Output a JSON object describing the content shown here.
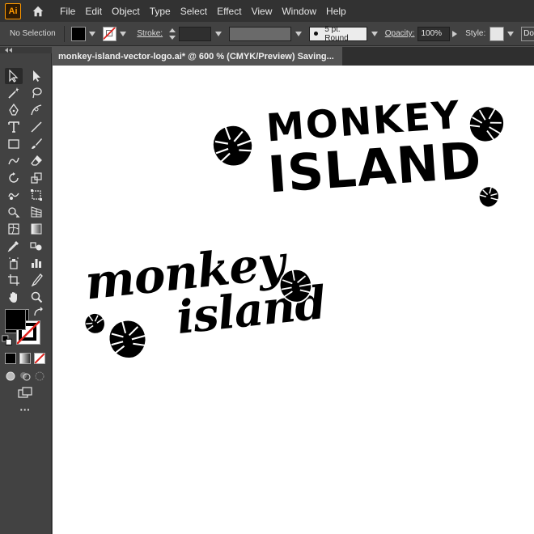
{
  "app": {
    "logo_text": "Ai",
    "home_icon": "home-icon"
  },
  "menu": {
    "items": [
      {
        "label": "File"
      },
      {
        "label": "Edit"
      },
      {
        "label": "Object"
      },
      {
        "label": "Type"
      },
      {
        "label": "Select"
      },
      {
        "label": "Effect"
      },
      {
        "label": "View"
      },
      {
        "label": "Window"
      },
      {
        "label": "Help"
      }
    ]
  },
  "control_bar": {
    "selection_label": "No Selection",
    "fill_color": "#000000",
    "stroke_label": "Stroke:",
    "brush_label": "5 pt. Round",
    "opacity_label": "Opacity:",
    "opacity_value": "100%",
    "style_label": "Style:",
    "doc_setup_label": "Do"
  },
  "document": {
    "tab_title": "monkey-island-vector-logo.ai* @ 600 % (CMYK/Preview) Saving..."
  },
  "toolbar": {
    "fill_color": "#000000",
    "stroke_color": "#ffffff",
    "more_label": "···"
  },
  "artwork": {
    "bold_logo": {
      "line1": "MONKEY",
      "line2": "ISLAND"
    },
    "script_logo": {
      "line1": "monkey",
      "line2": "island"
    }
  },
  "colors": {
    "menubar_bg": "#323232",
    "panel_bg": "#424242",
    "canvas_bg": "#535353",
    "artboard_bg": "#ffffff",
    "brand_orange": "#ff9a00",
    "ink": "#000000"
  }
}
